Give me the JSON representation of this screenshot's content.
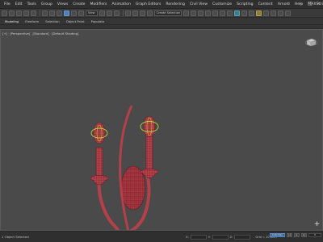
{
  "menubar": {
    "items": [
      "File",
      "Edit",
      "Tools",
      "Group",
      "Views",
      "Create",
      "Modifiers",
      "Animation",
      "Graph Editors",
      "Rendering",
      "Civil View",
      "Customize",
      "Scripting",
      "Content",
      "Arnold",
      "Help",
      "MAXScript"
    ]
  },
  "toolbar": {
    "selection_set_placeholder": "Create Selection Se",
    "view_dropdown": "View"
  },
  "ribbon": {
    "tabs": [
      "Modeling",
      "Freeform",
      "Selection",
      "Object Paint",
      "Populate"
    ]
  },
  "viewport": {
    "label_parts": [
      "[+]",
      "[Perspective]",
      "[Standard]",
      "[Default Shading]"
    ]
  },
  "statusbar": {
    "left_text": "1 Object Selected",
    "x_label": "X:",
    "y_label": "Y:",
    "z_label": "Z:",
    "grid_text": "Grid = 10.0cm",
    "add_time_tag": "Add Time Tag",
    "auto_key": "Auto Key",
    "set_key": "Set Key",
    "selected": "Selected",
    "frame": "0"
  },
  "colors": {
    "viewport_bg": "#4a4a4a",
    "mesh_fill": "#b4404a",
    "wire": "#5a1a22",
    "gizmo": "#b8d23c",
    "accent_blue": "#4f7fb8"
  }
}
